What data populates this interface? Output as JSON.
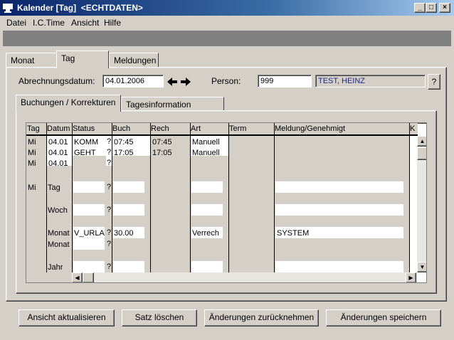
{
  "window": {
    "title": "Kalender [Tag]  <ECHTDATEN>",
    "controls": {
      "minimize": "_",
      "maximize": "□",
      "close": "×"
    }
  },
  "menu": [
    "Datei",
    "I.C.Time",
    "Ansicht",
    "Hilfe"
  ],
  "main_tabs": [
    "Monat",
    "Tag",
    "Meldungen"
  ],
  "form": {
    "abrechnungsdatum_label": "Abrechnungsdatum:",
    "abrechnungsdatum_value": "04.01.2006",
    "person_label": "Person:",
    "person_id": "999",
    "person_name": "TEST, HEINZ",
    "help": "?",
    "prev_icon": "arrow-left-icon",
    "next_icon": "arrow-right-icon"
  },
  "sub_tabs": [
    "Buchungen / Korrekturen",
    "Tagesinformation"
  ],
  "table": {
    "headers": [
      "Tag",
      "Datum",
      "Status",
      "Buch",
      "Rech",
      "Art",
      "Term",
      "Meldung/Genehmigt",
      "K"
    ],
    "rows": [
      {
        "tag": "Mi",
        "datum": "04.01",
        "status": "KOMM",
        "q": "?",
        "buch": "07:45",
        "rech": "07:45",
        "art": "Manuell",
        "term": "",
        "meldung": ""
      },
      {
        "tag": "Mi",
        "datum": "04.01",
        "status": "GEHT",
        "q": "?",
        "buch": "17:05",
        "rech": "17:05",
        "art": "Manuell",
        "term": "",
        "meldung": ""
      },
      {
        "tag": "Mi",
        "datum": "04.01",
        "status": "",
        "q": "?",
        "buch": "",
        "rech": "",
        "art": "",
        "term": "",
        "meldung": ""
      }
    ],
    "summary": [
      {
        "tag": "Mi",
        "label": "Tag",
        "status": "",
        "q": "?",
        "buch": "",
        "art": "",
        "meldung": ""
      },
      {
        "tag": "",
        "label": "Woch",
        "status": "",
        "q": "?",
        "buch": "",
        "art": "",
        "meldung": ""
      },
      {
        "tag": "",
        "label": "Monat",
        "status": "V_URLA",
        "q": "?",
        "buch": "30.00",
        "art": "Verrech",
        "meldung": "SYSTEM"
      },
      {
        "tag": "",
        "label": "Monat",
        "status": "",
        "q": "?",
        "buch": "",
        "art": "",
        "meldung": ""
      },
      {
        "tag": "",
        "label": "Jahr",
        "status": "",
        "q": "?",
        "buch": "",
        "art": "",
        "meldung": ""
      }
    ]
  },
  "buttons": {
    "refresh": "Ansicht aktualisieren",
    "delete": "Satz löschen",
    "revert": "Änderungen zurücknehmen",
    "save": "Änderungen speichern"
  },
  "colors": {
    "titlebar": "#0a246a",
    "face": "#d4d0c8",
    "person_name_text": "#1f2a8a"
  }
}
